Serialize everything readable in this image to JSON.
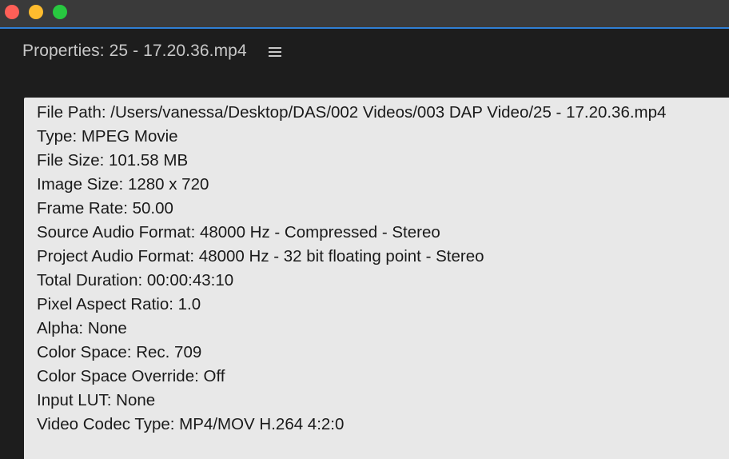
{
  "panel": {
    "title": "Properties: 25 - 17.20.36.mp4"
  },
  "properties": [
    "File Path: /Users/vanessa/Desktop/DAS/002 Videos/003 DAP Video/25 - 17.20.36.mp4",
    "Type: MPEG Movie",
    "File Size: 101.58 MB",
    "Image Size: 1280 x 720",
    "Frame Rate: 50.00",
    "Source Audio Format: 48000 Hz - Compressed - Stereo",
    "Project Audio Format: 48000 Hz - 32 bit floating point - Stereo",
    "Total Duration: 00:00:43:10",
    "Pixel Aspect Ratio: 1.0",
    "Alpha: None",
    "Color Space: Rec. 709",
    "Color Space Override: Off",
    "Input LUT: None",
    "Video Codec Type: MP4/MOV H.264 4:2:0"
  ],
  "icons": {
    "window_close": "traffic-light-close-icon",
    "window_minimize": "traffic-light-minimize-icon",
    "window_zoom": "traffic-light-zoom-icon",
    "panel_menu": "hamburger-menu-icon"
  },
  "colors": {
    "close": "#ff5f57",
    "minimize": "#febc2e",
    "zoom": "#28c840",
    "accent": "#2f7fd4"
  }
}
